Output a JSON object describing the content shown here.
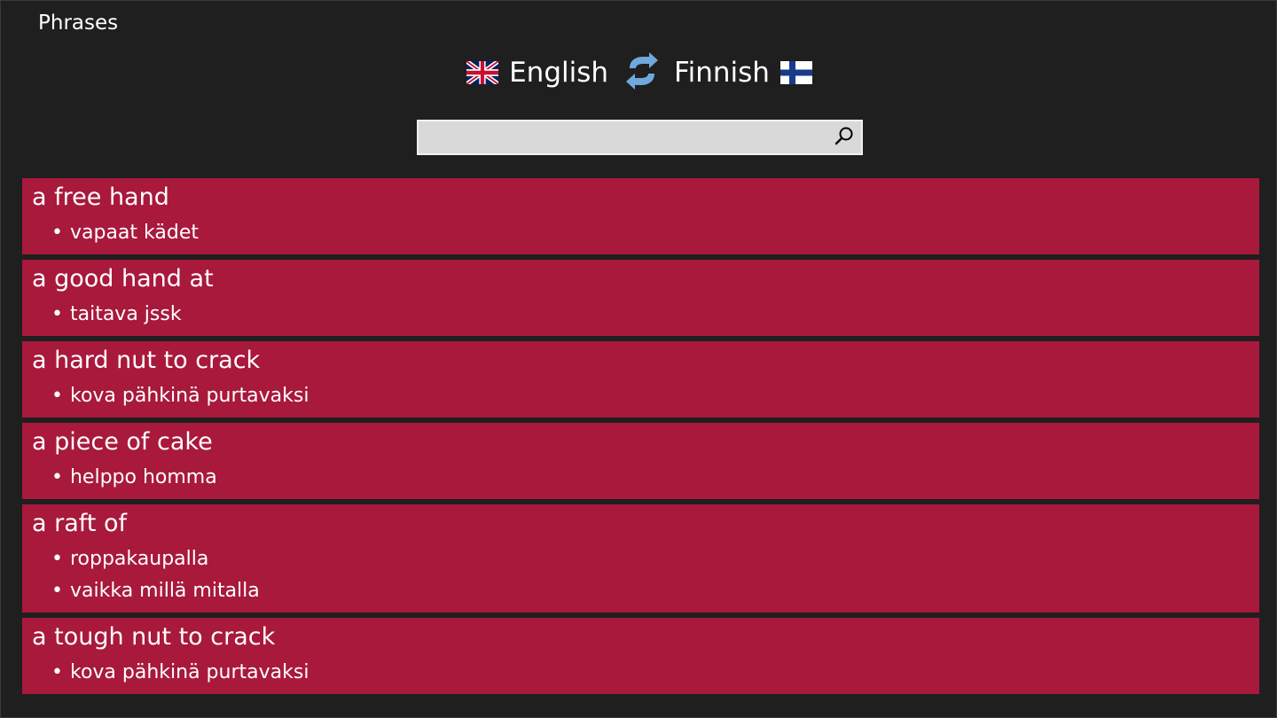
{
  "app": {
    "title": "Phrases"
  },
  "languages": {
    "source": {
      "name": "English",
      "flag_icon": "uk-flag-icon"
    },
    "target": {
      "name": "Finnish",
      "flag_icon": "finland-flag-icon"
    },
    "swap_icon": "swap-arrows-icon"
  },
  "search": {
    "value": "",
    "placeholder": "",
    "icon": "search-icon"
  },
  "colors": {
    "background": "#1f1f1f",
    "entry_background": "#a8193c",
    "search_background": "#d9d9d9",
    "swap_icon": "#6fa8dc"
  },
  "entries": [
    {
      "phrase": "a free hand",
      "translations": [
        "vapaat kädet"
      ]
    },
    {
      "phrase": "a good hand at",
      "translations": [
        "taitava jssk"
      ]
    },
    {
      "phrase": "a hard nut to crack",
      "translations": [
        "kova pähkinä purtavaksi"
      ]
    },
    {
      "phrase": "a piece of cake",
      "translations": [
        "helppo homma"
      ]
    },
    {
      "phrase": "a raft of",
      "translations": [
        "roppakaupalla",
        "vaikka millä mitalla"
      ]
    },
    {
      "phrase": "a tough nut to crack",
      "translations": [
        "kova pähkinä purtavaksi"
      ]
    }
  ]
}
